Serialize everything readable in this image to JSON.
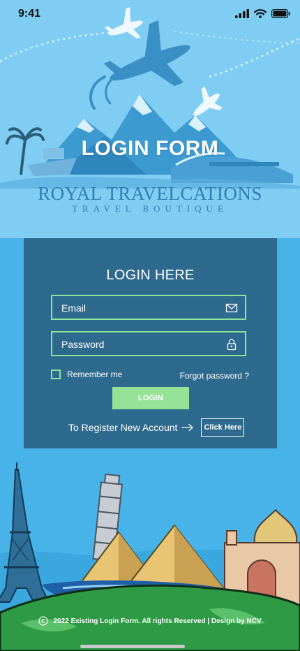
{
  "status_bar": {
    "time": "9:41"
  },
  "hero": {
    "title": "LOGIN FORM",
    "brand_name": "ROYAL TRAVELCATIONS",
    "brand_tagline": "TRAVEL BOUTIQUE"
  },
  "login_card": {
    "title": "LOGIN HERE",
    "email_placeholder": "Email",
    "password_placeholder": "Password",
    "remember_label": "Remember me",
    "forgot_label": "Forgot password ?",
    "login_label": "LOGIN",
    "register_text": "To Register New Account",
    "click_here_label": "Click Here"
  },
  "footer": {
    "text": "2022 Existing Login Form. All rights Reserved | Design by NCV"
  },
  "colors": {
    "hero_bg": "#7fcdf2",
    "page_bg": "#47b3e8",
    "card_bg": "#2e6a8d",
    "accent_green": "#96e398"
  }
}
